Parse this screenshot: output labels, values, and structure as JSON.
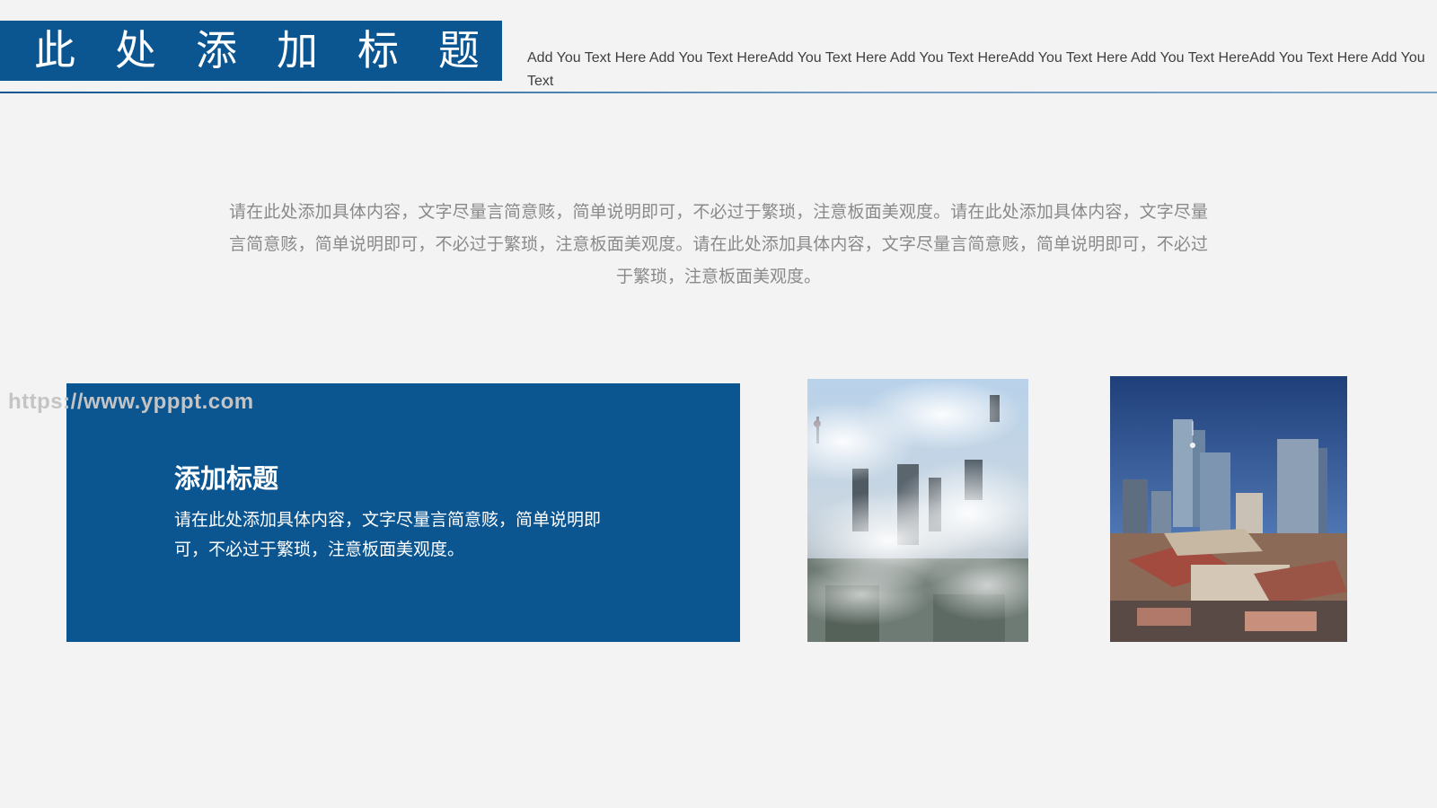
{
  "header": {
    "title": "此处添加标题",
    "subtitle": "Add You Text Here Add You Text HereAdd You Text Here Add You Text HereAdd You Text Here Add You Text HereAdd You Text Here Add You Text"
  },
  "intro": {
    "paragraph": "请在此处添加具体内容，文字尽量言简意赅，简单说明即可，不必过于繁琐，注意板面美观度。请在此处添加具体内容，文字尽量言简意赅，简单说明即可，不必过于繁琐，注意板面美观度。请在此处添加具体内容，文字尽量言简意赅，简单说明即可，不必过于繁琐，注意板面美观度。"
  },
  "watermark": {
    "text": "https://www.ypppt.com"
  },
  "card": {
    "title": "添加标题",
    "body": "请在此处添加具体内容，文字尽量言简意赅，简单说明即可，不必过于繁琐，注意板面美观度。"
  },
  "photos": [
    {
      "name": "foggy-skyline-aerial"
    },
    {
      "name": "city-skyscrapers"
    }
  ],
  "colors": {
    "accent": "#0b5591",
    "background": "#f3f3f4",
    "body_text": "#8a8a8a",
    "subtitle_text": "#404040"
  }
}
